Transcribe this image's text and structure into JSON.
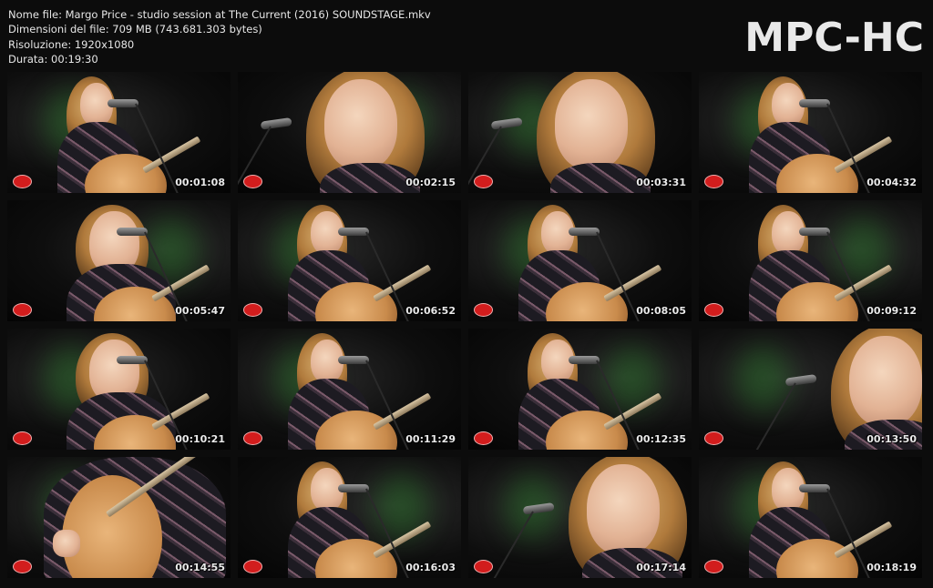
{
  "info": {
    "file_name": "Nome file: Margo Price - studio session at The Current (2016) SOUNDSTAGE.mkv",
    "file_size": "Dimensioni del file: 709 MB (743.681.303 bytes)",
    "resolution": "Risoluzione: 1920x1080",
    "duration": "Durata: 00:19:30"
  },
  "logo": "MPC-HC",
  "thumbnails": [
    {
      "time": "00:01:08",
      "shot": "wide"
    },
    {
      "time": "00:02:15",
      "shot": "closeup"
    },
    {
      "time": "00:03:31",
      "shot": "closeup"
    },
    {
      "time": "00:04:32",
      "shot": "wide"
    },
    {
      "time": "00:05:47",
      "shot": "medium"
    },
    {
      "time": "00:06:52",
      "shot": "wide"
    },
    {
      "time": "00:08:05",
      "shot": "wide"
    },
    {
      "time": "00:09:12",
      "shot": "wide"
    },
    {
      "time": "00:10:21",
      "shot": "medium"
    },
    {
      "time": "00:11:29",
      "shot": "wide"
    },
    {
      "time": "00:12:35",
      "shot": "wide"
    },
    {
      "time": "00:13:50",
      "shot": "closeup"
    },
    {
      "time": "00:14:55",
      "shot": "guitar"
    },
    {
      "time": "00:16:03",
      "shot": "wide"
    },
    {
      "time": "00:17:14",
      "shot": "closeup"
    },
    {
      "time": "00:18:19",
      "shot": "wide"
    }
  ]
}
